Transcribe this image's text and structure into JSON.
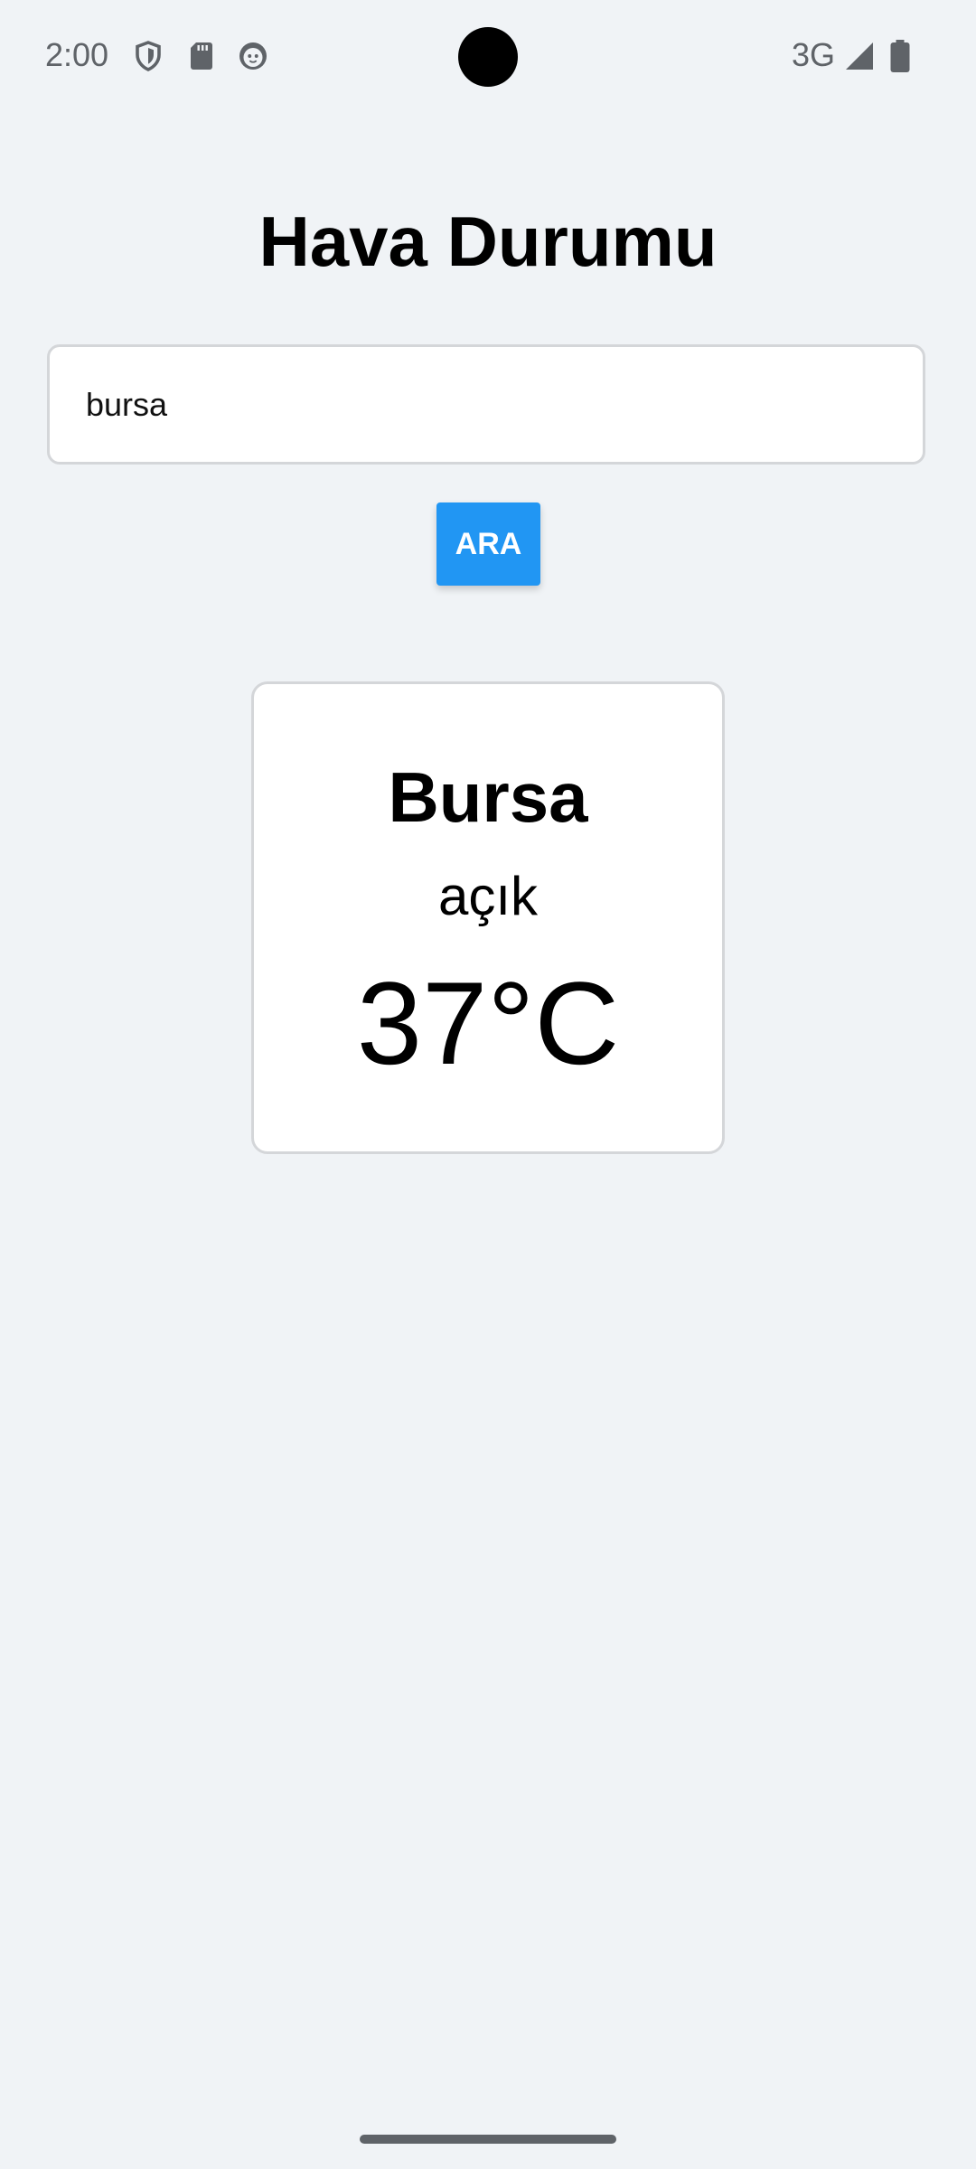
{
  "status_bar": {
    "time": "2:00",
    "network": "3G",
    "icons": [
      "shield-icon",
      "sd-card-icon",
      "face-icon",
      "signal-icon",
      "battery-icon"
    ]
  },
  "page": {
    "title": "Hava Durumu"
  },
  "search": {
    "value": "bursa",
    "button_label": "ARA",
    "button_color": "#2196f3"
  },
  "weather": {
    "city": "Bursa",
    "description": "açık",
    "temperature": "37°C"
  },
  "colors": {
    "background": "#f0f3f6",
    "card": "#ffffff",
    "accent": "#2196f3"
  }
}
